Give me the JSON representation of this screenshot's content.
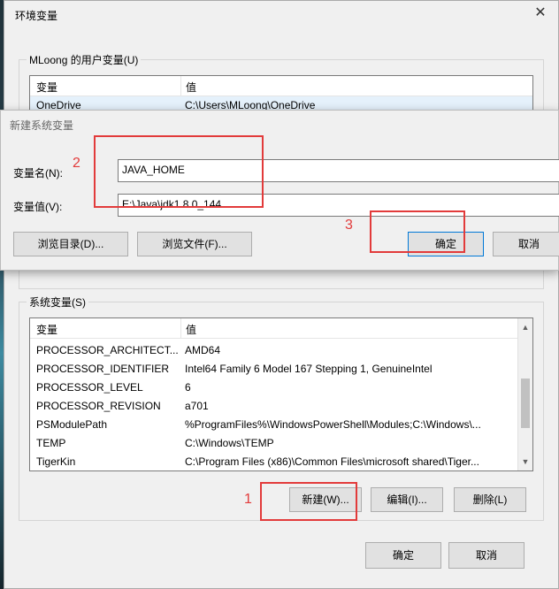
{
  "window": {
    "title": "环境变量"
  },
  "user_vars": {
    "group_label": "MLoong 的用户变量(U)",
    "columns": [
      "变量",
      "值"
    ],
    "rows": [
      {
        "name": "OneDrive",
        "value": "C:\\Users\\MLoong\\OneDrive"
      }
    ]
  },
  "new_dialog": {
    "title": "新建系统变量",
    "name_label": "变量名(N):",
    "name_value": "JAVA_HOME",
    "value_label": "变量值(V):",
    "value_value": "E:\\Java\\jdk1.8.0_144",
    "browse_dir": "浏览目录(D)...",
    "browse_file": "浏览文件(F)...",
    "ok": "确定",
    "cancel": "取消"
  },
  "sys_vars": {
    "group_label": "系统变量(S)",
    "columns": [
      "变量",
      "值"
    ],
    "rows": [
      {
        "name": "PROCESSOR_ARCHITECT...",
        "value": "AMD64"
      },
      {
        "name": "PROCESSOR_IDENTIFIER",
        "value": "Intel64 Family 6 Model 167 Stepping 1, GenuineIntel"
      },
      {
        "name": "PROCESSOR_LEVEL",
        "value": "6"
      },
      {
        "name": "PROCESSOR_REVISION",
        "value": "a701"
      },
      {
        "name": "PSModulePath",
        "value": "%ProgramFiles%\\WindowsPowerShell\\Modules;C:\\Windows\\..."
      },
      {
        "name": "TEMP",
        "value": "C:\\Windows\\TEMP"
      },
      {
        "name": "TigerKin",
        "value": "C:\\Program Files (x86)\\Common Files\\microsoft shared\\Tiger..."
      }
    ],
    "new_btn": "新建(W)...",
    "edit_btn": "编辑(I)...",
    "delete_btn": "删除(L)"
  },
  "bottom": {
    "ok": "确定",
    "cancel": "取消"
  },
  "annotations": [
    "1",
    "2",
    "3"
  ],
  "colors": {
    "annotation": "#e23b3b",
    "accent": "#0078d7"
  },
  "icons": {
    "close": "close-icon",
    "scroll_up": "scroll-up-icon",
    "scroll_down": "scroll-down-icon"
  }
}
